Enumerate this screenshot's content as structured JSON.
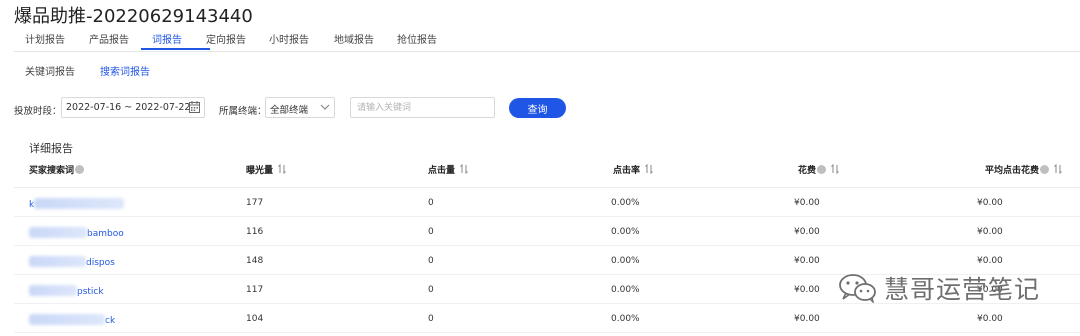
{
  "page": {
    "title": "爆品助推-20220629143440"
  },
  "tabs": [
    {
      "label": "计划报告"
    },
    {
      "label": "产品报告"
    },
    {
      "label": "词报告",
      "active": true
    },
    {
      "label": "定向报告"
    },
    {
      "label": "小时报告"
    },
    {
      "label": "地域报告"
    },
    {
      "label": "抢位报告"
    }
  ],
  "subtabs": [
    {
      "label": "关键词报告"
    },
    {
      "label": "搜索词报告",
      "active": true
    }
  ],
  "filters": {
    "date_label": "投放时段：",
    "date_range": "2022-07-16 ~ 2022-07-22",
    "terminal_label": "所属终端：",
    "terminal_value": "全部终端",
    "keyword_placeholder": "请输入关键词",
    "query_label": "查询"
  },
  "table": {
    "section_title": "详细报告",
    "columns": [
      "买家搜索词",
      "曝光量",
      "点击量",
      "点击率",
      "花费",
      "平均点击花费"
    ],
    "rows": [
      {
        "keyword": "k",
        "impressions": "177",
        "clicks": "0",
        "ctr": "0.00%",
        "cost": "¥0.00",
        "avg_cpc": "¥0.00"
      },
      {
        "keyword": "bamboo",
        "impressions": "116",
        "clicks": "0",
        "ctr": "0.00%",
        "cost": "¥0.00",
        "avg_cpc": "¥0.00"
      },
      {
        "keyword": "dispos",
        "impressions": "148",
        "clicks": "0",
        "ctr": "0.00%",
        "cost": "¥0.00",
        "avg_cpc": "¥0.00"
      },
      {
        "keyword": "pstick",
        "impressions": "117",
        "clicks": "0",
        "ctr": "0.00%",
        "cost": "¥0.00",
        "avg_cpc": "¥0.00"
      },
      {
        "keyword": "ck",
        "impressions": "104",
        "clicks": "0",
        "ctr": "0.00%",
        "cost": "¥0.00",
        "avg_cpc": "¥0.00"
      }
    ]
  },
  "watermark": {
    "text": "慧哥运营笔记"
  },
  "colors": {
    "accent": "#1f56e6",
    "text": "#333333",
    "border": "#d9d9d9",
    "watermark": "#6f6f6f"
  }
}
